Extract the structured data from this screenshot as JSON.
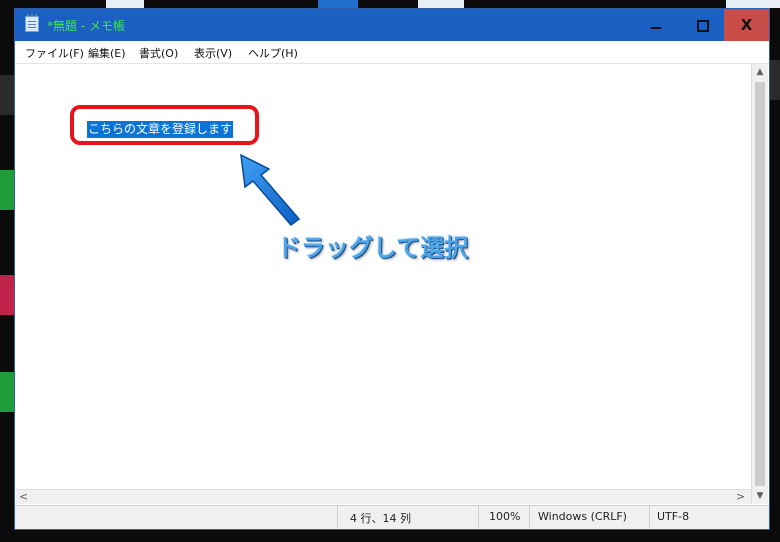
{
  "window": {
    "title": "*無題 - メモ帳",
    "minimize_label": "",
    "maximize_label": "",
    "close_label": "X"
  },
  "menu": {
    "items": [
      {
        "label": "ファイル(F)"
      },
      {
        "label": "編集(E)"
      },
      {
        "label": "書式(O)"
      },
      {
        "label": "表示(V)"
      },
      {
        "label": "ヘルプ(H)"
      }
    ]
  },
  "editor": {
    "selected_text": "こちらの文章を登録します"
  },
  "annotation": {
    "callout_text": "ドラッグして選択",
    "highlight_color": "#e8141c",
    "arrow_color": "#1e7be0"
  },
  "statusbar": {
    "position": "4 行、14 列",
    "zoom": "100%",
    "line_ending": "Windows (CRLF)",
    "encoding": "UTF-8"
  },
  "colors": {
    "titlebar": "#1b5fc2",
    "title_text": "#3fe84f",
    "close_button": "#c84c48",
    "selection": "#0b74d6"
  }
}
